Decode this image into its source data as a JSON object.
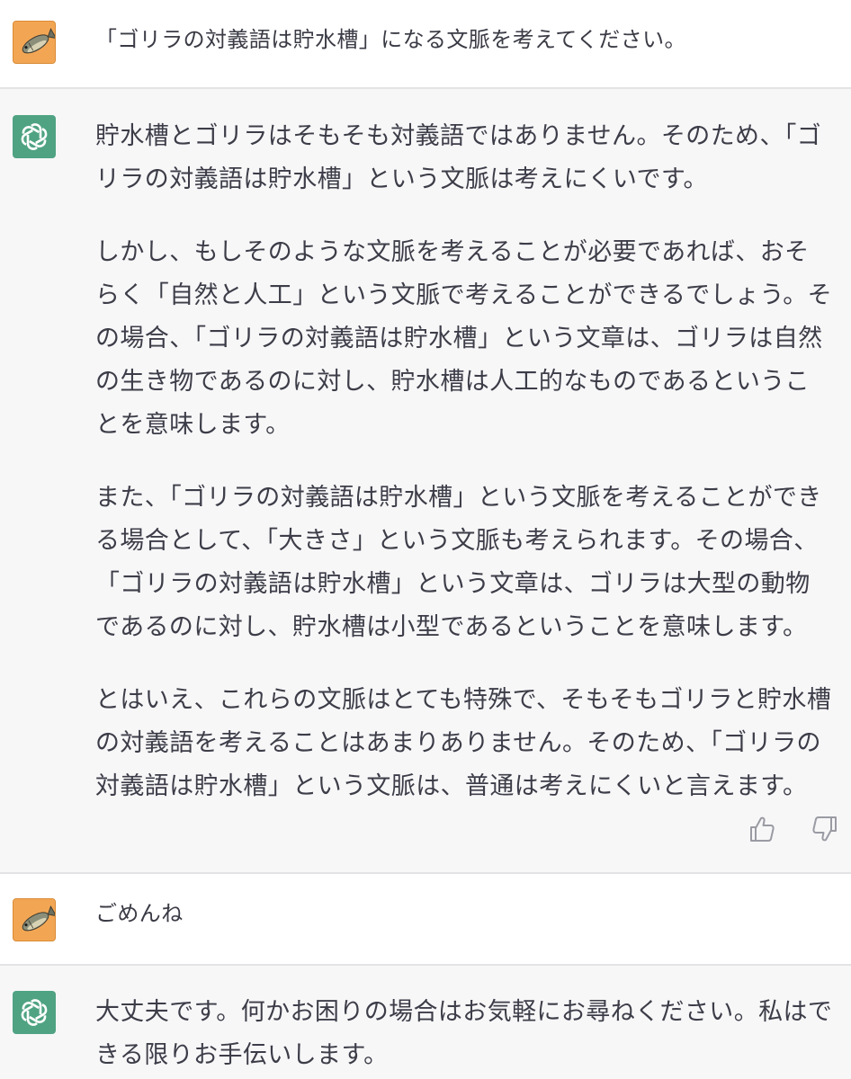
{
  "conversation": {
    "turn1_user": {
      "text": "「ゴリラの対義語は貯水槽」になる文脈を考えてください。"
    },
    "turn1_assistant": {
      "paragraphs": [
        "貯水槽とゴリラはそもそも対義語ではありません。そのため、「ゴリラの対義語は貯水槽」という文脈は考えにくいです。",
        "しかし、もしそのような文脈を考えることが必要であれば、おそらく「自然と人工」という文脈で考えることができるでしょう。その場合、「ゴリラの対義語は貯水槽」という文章は、ゴリラは自然の生き物であるのに対し、貯水槽は人工的なものであるということを意味します。",
        "また、「ゴリラの対義語は貯水槽」という文脈を考えることができる場合として、「大きさ」という文脈も考えられます。その場合、「ゴリラの対義語は貯水槽」という文章は、ゴリラは大型の動物であるのに対し、貯水槽は小型であるということを意味します。",
        "とはいえ、これらの文脈はとても特殊で、そもそもゴリラと貯水槽の対義語を考えることはあまりありません。そのため、「ゴリラの対義語は貯水槽」という文脈は、普通は考えにくいと言えます。"
      ]
    },
    "turn2_user": {
      "text": "ごめんね"
    },
    "turn2_assistant": {
      "paragraphs": [
        "大丈夫です。何かお困りの場合はお気軽にお尋ねください。私はできる限りお手伝いします。"
      ]
    }
  },
  "icons": {
    "user_avatar": "fish-avatar-icon",
    "assistant_avatar": "openai-logo-icon",
    "thumbs_up": "thumbs-up-icon",
    "thumbs_down": "thumbs-down-icon"
  },
  "colors": {
    "assistant_bg": "#f7f7f8",
    "user_bg": "#ffffff",
    "assistant_avatar_bg": "#4fa382",
    "user_avatar_bg": "#f2a654",
    "text": "#343541",
    "separator": "#e3e3e6"
  }
}
